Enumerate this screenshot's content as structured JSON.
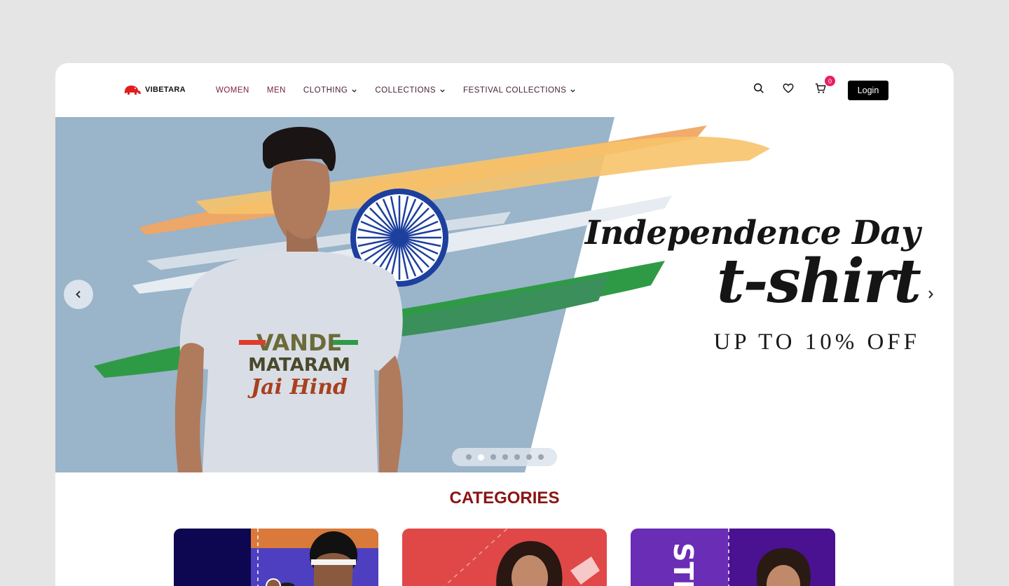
{
  "brand": {
    "name": "VIBETARA"
  },
  "nav": {
    "items": [
      {
        "label": "WOMEN",
        "has_dropdown": false
      },
      {
        "label": "MEN",
        "has_dropdown": false
      },
      {
        "label": "CLOTHING",
        "has_dropdown": true
      },
      {
        "label": "COLLECTIONS",
        "has_dropdown": true
      },
      {
        "label": "FESTIVAL COLLECTIONS",
        "has_dropdown": true
      }
    ],
    "cart_count": "0",
    "login_label": "Login",
    "icons": [
      "search-icon",
      "heart-icon",
      "cart-icon"
    ]
  },
  "hero": {
    "title": "Independence Day",
    "subtitle": "t-shirt",
    "offer": "UP TO 10% OFF",
    "tshirt_print": [
      "VANDE",
      "MATARAM",
      "Jai Hind"
    ],
    "slide_count": 7,
    "active_slide": 1
  },
  "categories": {
    "heading": "CATEGORIES",
    "cards": [
      {
        "accent": "#0d0650"
      },
      {
        "accent": "#e04848"
      },
      {
        "accent": "#6a2db5",
        "label_fragment": "STIC"
      }
    ]
  },
  "colors": {
    "page_bg": "#e5e5e5",
    "nav_link": "#7a1f3d",
    "cart_badge": "#e91e63",
    "heading": "#8b1414",
    "hero_bg": "#9ab4c9"
  }
}
